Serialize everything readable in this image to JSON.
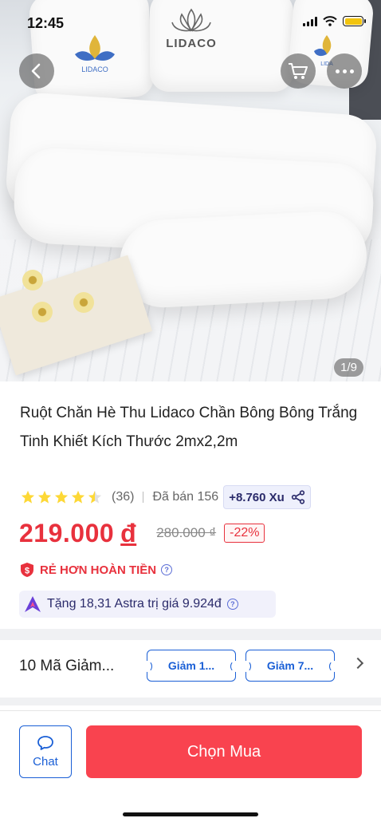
{
  "status_bar": {
    "time": "12:45"
  },
  "hero": {
    "brand": "LIDACO",
    "image_counter": "1/9"
  },
  "product": {
    "title": "Ruột Chăn Hè Thu Lidaco Chần Bông Bông Trắng Tinh Khiết Kích Thước 2mx2,2m",
    "rating": 4.5,
    "rating_count": "(36)",
    "sold": "Đã bán 156",
    "xu": "+8.760 Xu",
    "price": "219.000",
    "currency": "đ",
    "old_price": "280.000 ₫",
    "discount": "-22%",
    "cheaper_label": "RẺ HƠN HOÀN TIỀN",
    "astra_text": "Tặng 18,31 Astra trị giá 9.924đ"
  },
  "vouchers": {
    "title": "10 Mã Giảm...",
    "items": [
      "Giảm 1...",
      "Giảm 7..."
    ]
  },
  "bottom_bar": {
    "chat_label": "Chat",
    "buy_label": "Chọn Mua"
  },
  "colors": {
    "price_red": "#e8313d",
    "buy_button": "#f9434f",
    "link_blue": "#1a5fd6"
  },
  "icons": [
    "back-icon",
    "cart-icon",
    "more-icon",
    "share-icon",
    "shield-dollar-icon",
    "info-icon",
    "astra-icon",
    "chat-icon",
    "chevron-right-icon"
  ]
}
